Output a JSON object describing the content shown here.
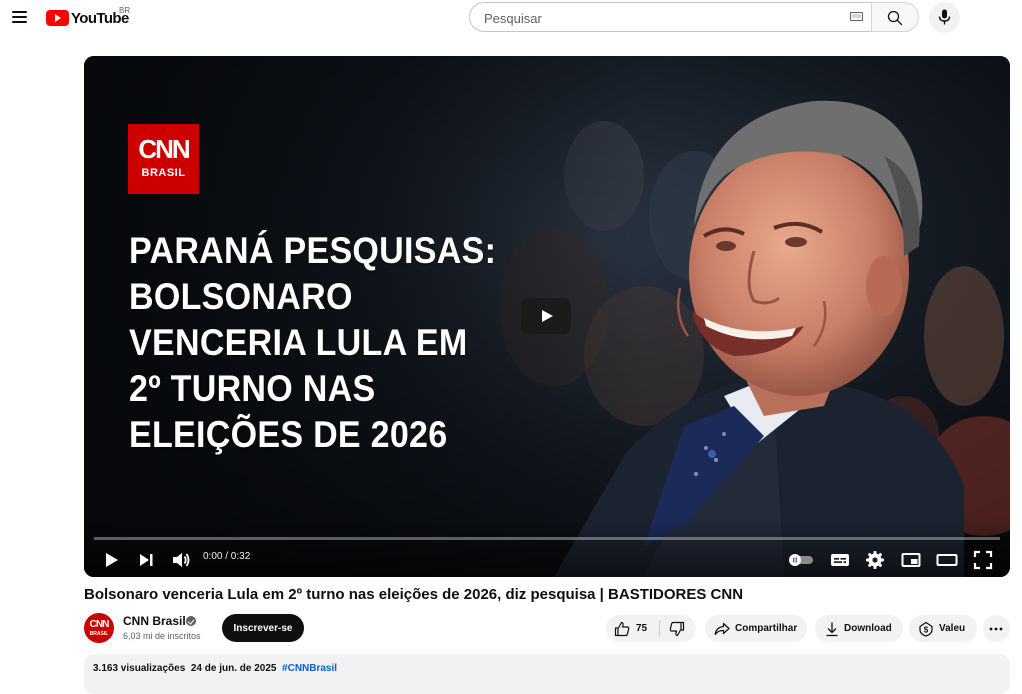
{
  "header": {
    "logo_text": "YouTube",
    "country_code": "BR",
    "search_placeholder": "Pesquisar"
  },
  "player": {
    "thumbnail": {
      "brand_top": "CNN",
      "brand_bottom": "BRASIL",
      "headline_lines": [
        "PARANÁ PESQUISAS:",
        "BOLSONARO",
        "VENCERIA LULA EM",
        "2º TURNO NAS",
        "ELEIÇÕES DE 2026"
      ]
    },
    "time_current": "0:00",
    "time_total": "0:32",
    "time_display": "0:00 / 0:32",
    "progress_fraction": 0
  },
  "video": {
    "title": "Bolsonaro venceria Lula em 2º turno nas eleições de 2026, diz pesquisa | BASTIDORES CNN"
  },
  "channel": {
    "name": "CNN Brasil",
    "subscribers": "6,03 mi de inscritos",
    "avatar_top": "CNN",
    "avatar_bottom": "BRASIL",
    "subscribe_label": "Inscrever-se",
    "verified": true
  },
  "actions": {
    "like_count": "75",
    "share_label": "Compartilhar",
    "download_label": "Download",
    "thanks_label": "Valeu"
  },
  "description": {
    "views": "3.163 visualizações",
    "date": "24 de jun. de 2025",
    "hashtag": "#CNNBrasil"
  },
  "colors": {
    "brand_red": "#ff0000",
    "cnn_red": "#cc0000",
    "link_blue": "#065fd4",
    "pill_bg": "#f2f2f2",
    "text_primary": "#0f0f0f",
    "text_secondary": "#606060"
  },
  "icons": {
    "menu": "hamburger-menu-icon",
    "keyboard": "keyboard-icon",
    "search": "search-icon",
    "mic": "microphone-icon",
    "play": "play-icon",
    "next": "next-icon",
    "volume": "volume-icon",
    "autoplay": "autoplay-toggle-icon",
    "captions": "captions-icon",
    "settings": "gear-icon",
    "miniplayer": "miniplayer-icon",
    "theater": "theater-mode-icon",
    "fullscreen": "fullscreen-icon",
    "like": "thumbs-up-icon",
    "dislike": "thumbs-down-icon",
    "share": "share-icon",
    "download": "download-icon",
    "thanks": "super-thanks-icon",
    "more": "more-icon"
  }
}
